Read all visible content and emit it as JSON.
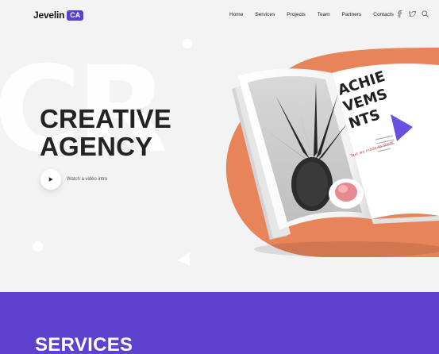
{
  "header": {
    "logo_text": "Jevelin",
    "logo_badge": "CA",
    "nav": [
      "Home",
      "Services",
      "Projects",
      "Team",
      "Partners",
      "Contacts"
    ],
    "icons": [
      "facebook-icon",
      "twitter-icon",
      "search-icon"
    ]
  },
  "hero": {
    "background_letters": "CR",
    "headline_line1": "CREATIVE",
    "headline_line2": "AGENCY",
    "video_label": "Watch a video intro"
  },
  "magazine": {
    "title_lines": [
      "ACHIE",
      "VEMS",
      "NTS"
    ],
    "small_text": "Text we made to share"
  },
  "services": {
    "title": "SERVICES"
  },
  "colors": {
    "accent": "#5d41cf",
    "orange": "#e8845a",
    "hero_bg": "#f3f3f3",
    "text_dark": "#232323"
  }
}
